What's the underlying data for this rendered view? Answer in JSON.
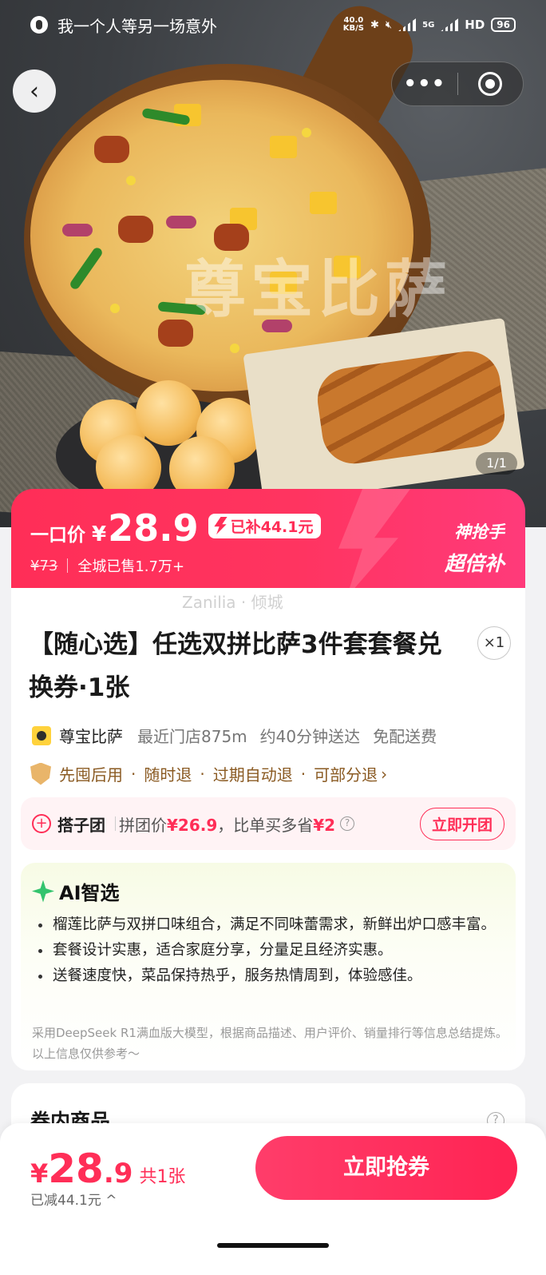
{
  "status_bar": {
    "app_title": "我一个人等另一场意外",
    "net_speed_value": "40.0",
    "net_speed_unit": "KB/S",
    "network": "5G",
    "hd": "HD",
    "battery": "96"
  },
  "nav": {
    "back_icon": "chevron-left-icon",
    "more_label": "•••",
    "close_icon": "target-icon"
  },
  "hero": {
    "watermark": "尊宝比萨",
    "image_counter": "1/1"
  },
  "price_banner": {
    "label": "一口价",
    "currency": "¥",
    "price": "28.9",
    "subsidy": "已补44.1元",
    "original_price": "¥73",
    "sold": "全城已售1.7万+",
    "promo_line1": "神抢手",
    "promo_line2": "超倍补",
    "colors": {
      "accent": "#ff2e57",
      "accent_end": "#ff3a7a"
    }
  },
  "product": {
    "overlay_text": "Zanilia · 倾城",
    "title": "【随心选】任选双拼比萨3件套套餐兑换券·1张",
    "quantity": "×1",
    "store_name": "尊宝比萨",
    "distance": "最近门店875m",
    "delivery_time": "约40分钟送达",
    "delivery_fee": "免配送费",
    "guarantees": [
      "先囤后用",
      "随时退",
      "过期自动退",
      "可部分退"
    ]
  },
  "group_buy": {
    "name": "搭子团",
    "desc_prefix": "拼团价",
    "group_price": "¥26.9",
    "desc_mid": "，比单买多省",
    "saving": "¥2",
    "button": "立即开团"
  },
  "ai_summary": {
    "title": "AI智选",
    "points": [
      "榴莲比萨与双拼口味组合，满足不同味蕾需求，新鲜出炉口感丰富。",
      "套餐设计实惠，适合家庭分享，分量足且经济实惠。",
      "送餐速度快，菜品保持热乎，服务热情周到，体验感佳。"
    ],
    "note": "采用DeepSeek R1满血版大模型，根据商品描述、用户评价、销量排行等信息总结提炼。以上信息仅供参考～"
  },
  "coupon_section": {
    "title": "券内商品"
  },
  "bottom_bar": {
    "currency": "¥",
    "price_int": "28",
    "price_dec": ".9",
    "count": "共1张",
    "reduced": "已减44.1元 ^",
    "buy_button": "立即抢券"
  }
}
